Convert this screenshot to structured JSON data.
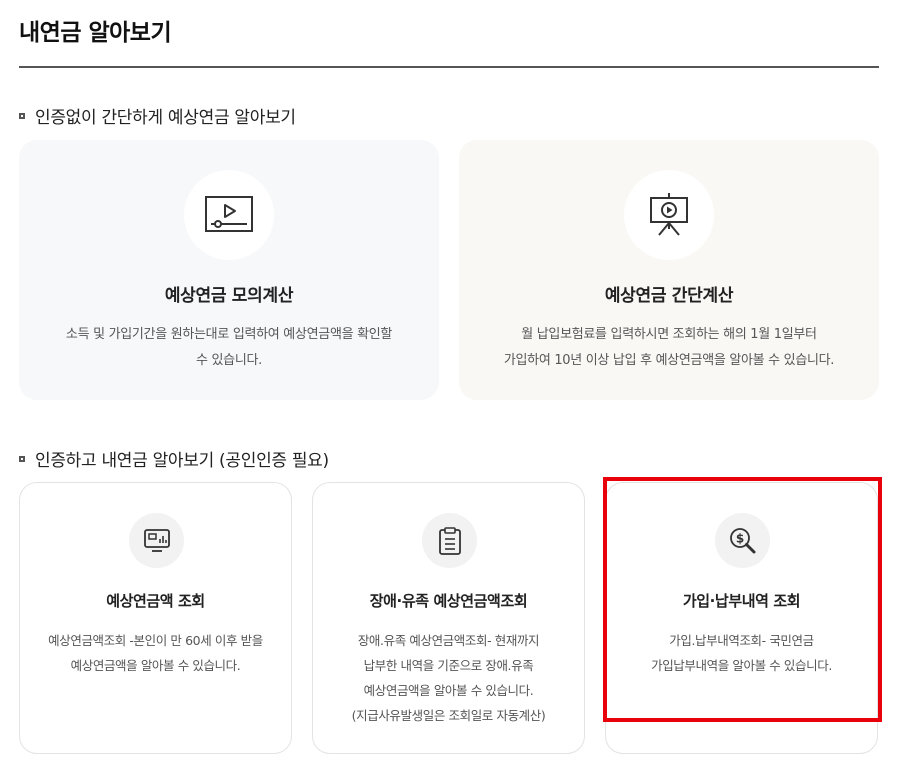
{
  "page": {
    "title": "내연금 알아보기"
  },
  "section1": {
    "heading": "인증없이 간단하게 예상연금 알아보기",
    "cards": [
      {
        "title": "예상연금 모의계산",
        "desc": [
          "소득 및 가입기간을 원하는대로 입력하여 예상연금액을 확인할",
          "수 있습니다."
        ],
        "icon": "video-player-icon"
      },
      {
        "title": "예상연금 간단계산",
        "desc": [
          "월 납입보험료를 입력하시면 조회하는 해의 1월 1일부터",
          "가입하여 10년 이상 납입 후 예상연금액을 알아볼 수 있습니다."
        ],
        "icon": "presentation-board-icon"
      }
    ]
  },
  "section2": {
    "heading": "인증하고 내연금 알아보기 (공인인증 필요)",
    "cards": [
      {
        "title": "예상연금액 조회",
        "desc": [
          "예상연금액조회 -본인이 만 60세 이후 받을",
          "예상연금액을 알아볼 수 있습니다."
        ],
        "icon": "monitor-chart-icon"
      },
      {
        "title": "장애·유족 예상연금액조회",
        "desc": [
          "장애.유족 예상연금액조회- 현재까지",
          "납부한 내역을 기준으로 장애.유족",
          "예상연금액을 알아볼 수 있습니다.",
          "(지급사유발생일은 조회일로 자동계산)"
        ],
        "icon": "clipboard-icon"
      },
      {
        "title": "가입·납부내역 조회",
        "desc": [
          "가입.납부내역조회- 국민연금",
          "가입납부내역을 알아볼 수 있습니다."
        ],
        "icon": "dollar-search-icon"
      }
    ]
  },
  "colors": {
    "highlight": "#e8000b",
    "card_a_bg": "#f7f8fa",
    "card_b_bg": "#faf8f5"
  }
}
